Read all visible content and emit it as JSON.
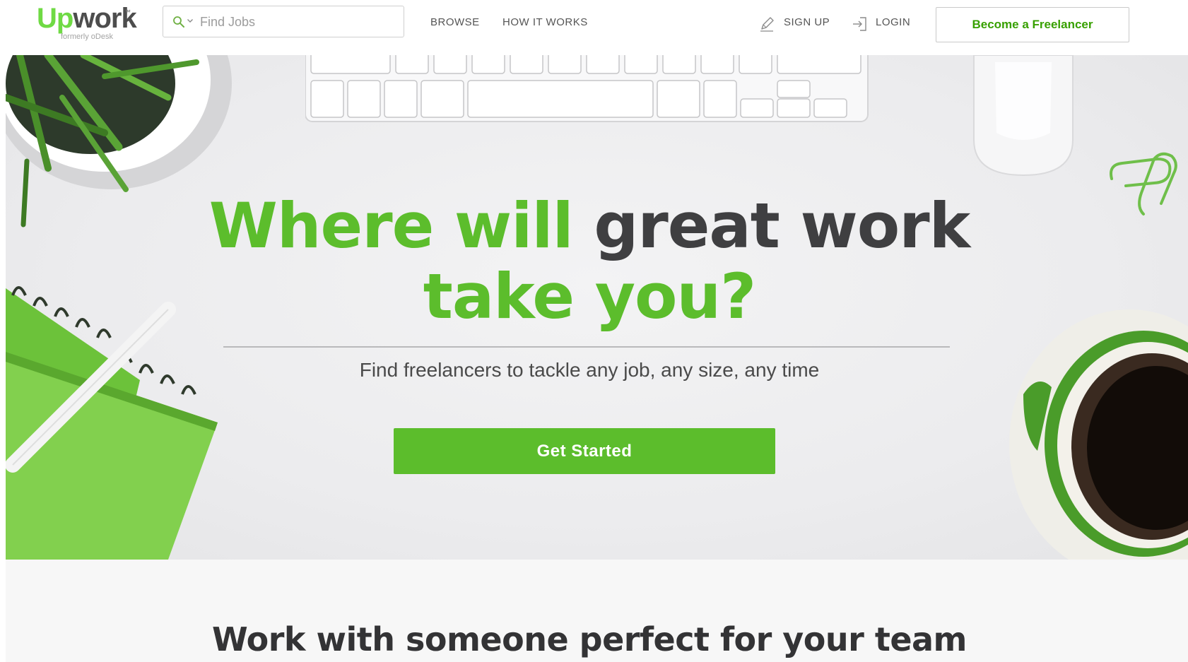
{
  "header": {
    "logo": {
      "text_up": "Up",
      "text_work": "work",
      "tm": "™",
      "subtext": "formerly oDesk"
    },
    "search": {
      "placeholder": "Find Jobs",
      "value": ""
    },
    "nav": {
      "browse": "BROWSE",
      "how_it_works": "HOW IT WORKS",
      "sign_up": "SIGN UP",
      "login": "LOGIN"
    },
    "cta_label": "Become a Freelancer"
  },
  "hero": {
    "title_green_1": "Where will",
    "title_dark": "great work",
    "title_green_2": "take you?",
    "subtitle": "Find freelancers to tackle any job, any size, any time",
    "button_label": "Get Started"
  },
  "section": {
    "title": "Work with someone perfect for your team"
  },
  "colors": {
    "brand_green": "#5cbd2c",
    "logo_green": "#6fda44",
    "link_green": "#37a000",
    "dark_text": "#3f3f41"
  },
  "icons": {
    "search": "search-icon",
    "caret": "chevron-down-icon",
    "sign_up": "pencil-icon",
    "login": "login-icon"
  }
}
